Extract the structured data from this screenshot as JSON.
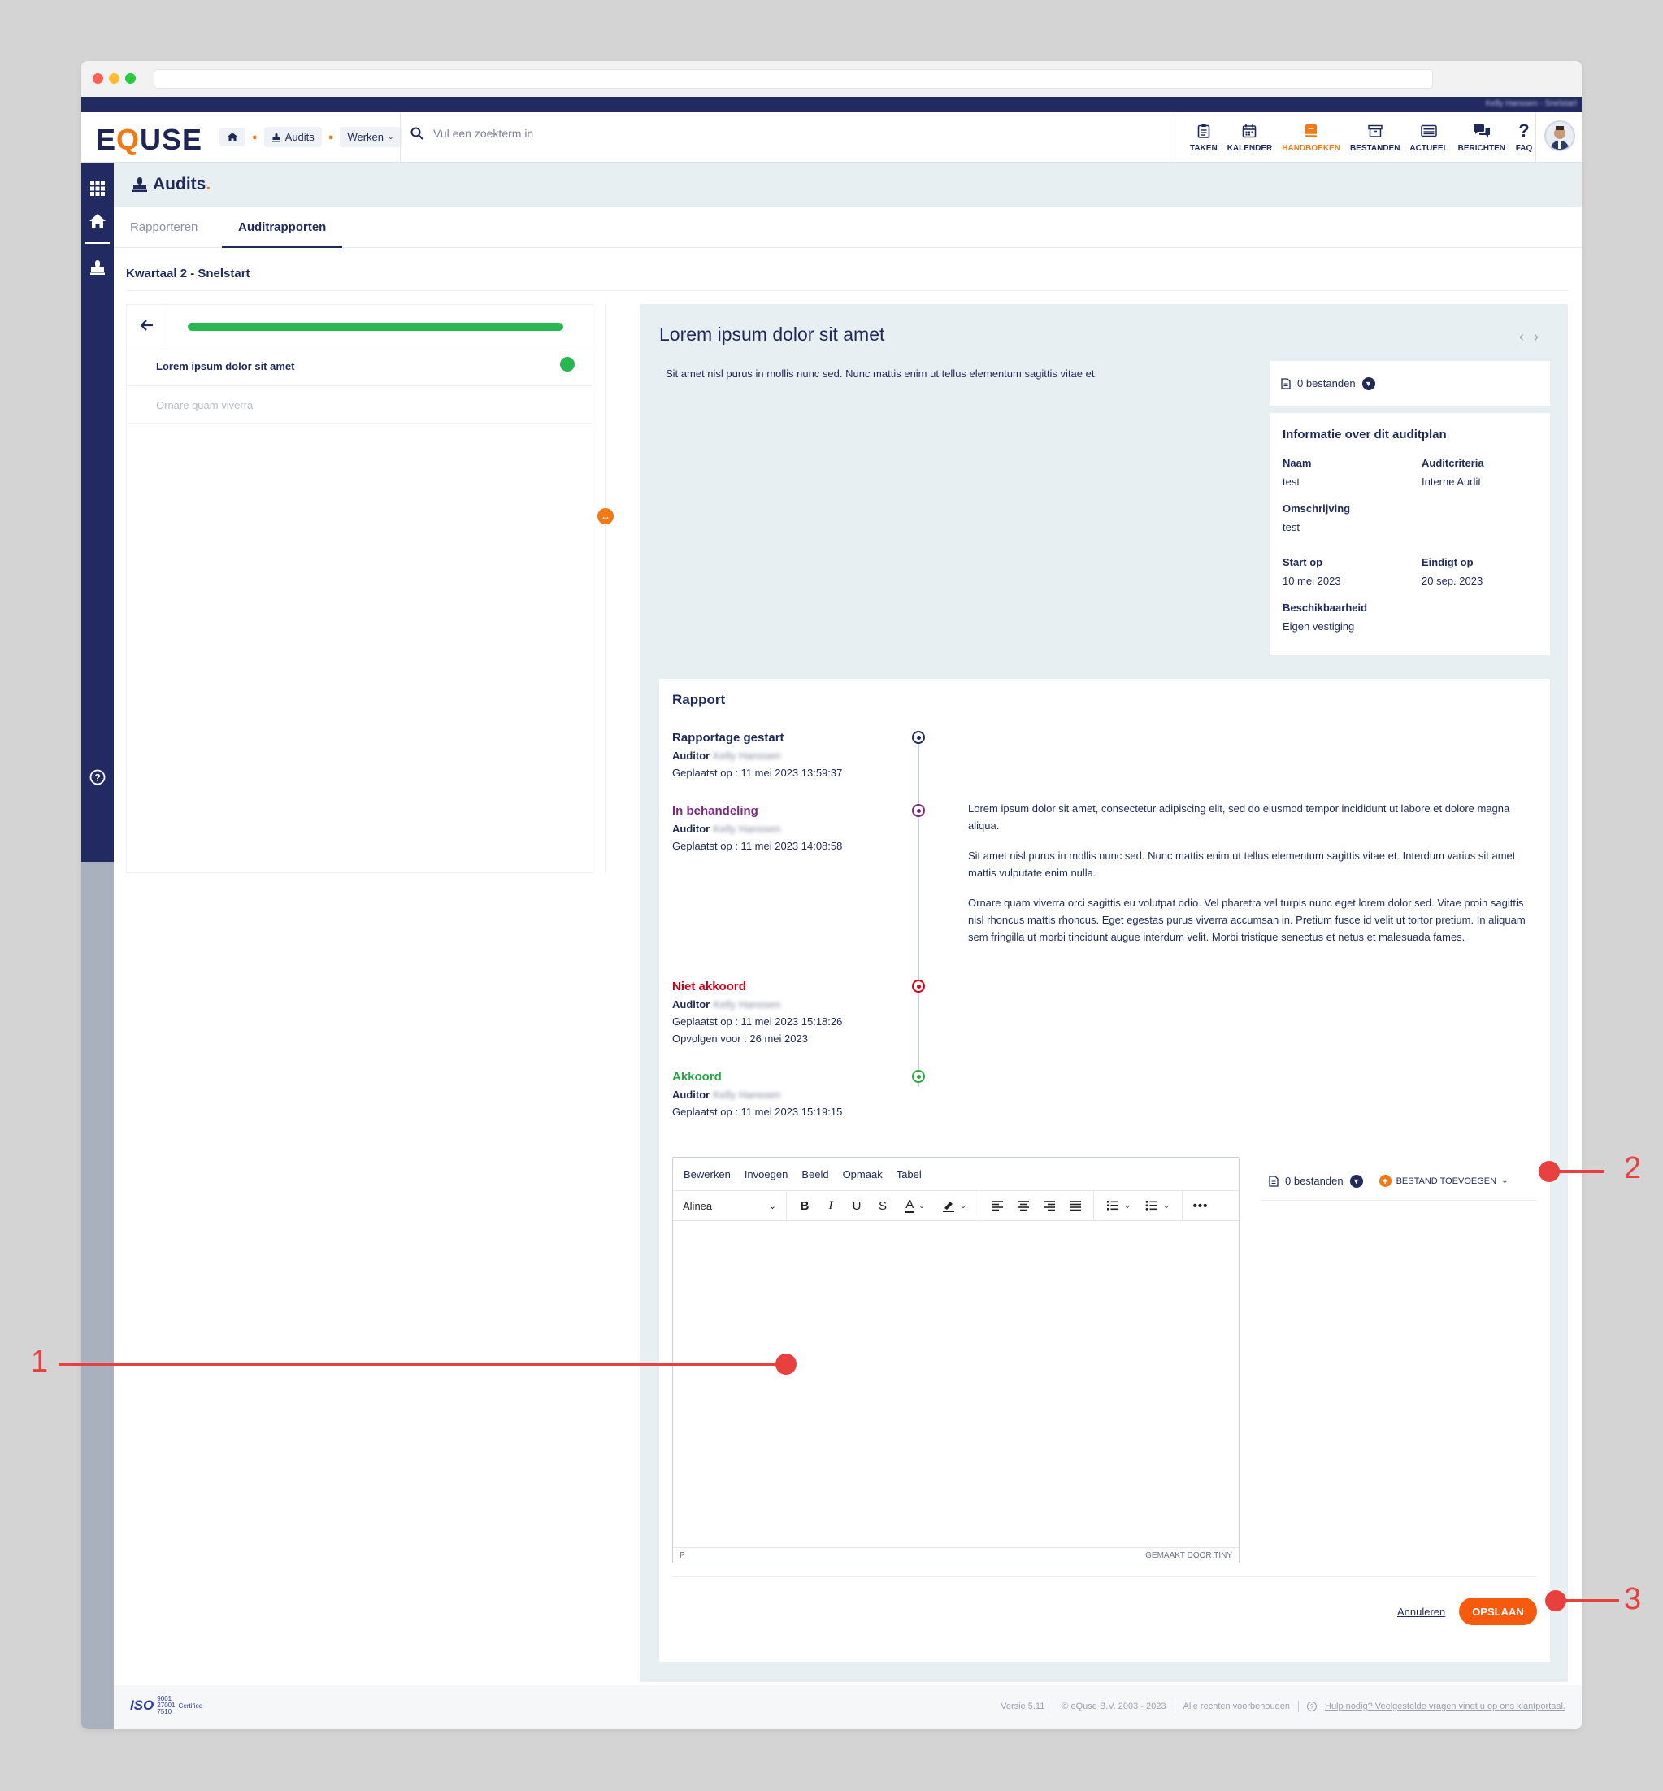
{
  "browser": {
    "url": ""
  },
  "header": {
    "user_name": "Kelly Hanssen - Snelstart",
    "logo": {
      "pre": "E",
      "q": "Q",
      "post": "USE"
    },
    "breadcrumb": [
      {
        "label": "Audits"
      },
      {
        "label": "Werken"
      }
    ],
    "search_placeholder": "Vul een zoekterm in",
    "nav": [
      {
        "label": "TAKEN",
        "icon": "clipboard-icon"
      },
      {
        "label": "KALENDER",
        "icon": "calendar-icon"
      },
      {
        "label": "HANDBOEKEN",
        "icon": "book-icon",
        "active": true
      },
      {
        "label": "BESTANDEN",
        "icon": "archive-icon"
      },
      {
        "label": "ACTUEEL",
        "icon": "news-icon"
      },
      {
        "label": "BERICHTEN",
        "icon": "chat-icon"
      },
      {
        "label": "FAQ",
        "icon": "question-icon"
      }
    ]
  },
  "page": {
    "title": "Audits",
    "title_dot": ".",
    "tabs": [
      "Rapporteren",
      "Auditrapporten"
    ],
    "active_tab": "Auditrapporten",
    "subtitle": "Kwartaal 2 - Snelstart"
  },
  "left_panel": {
    "progress": 1.0,
    "items": [
      {
        "label": "Lorem ipsum dolor sit amet",
        "status": "done"
      },
      {
        "label": "Ornare quam viverra",
        "status": "disabled"
      }
    ]
  },
  "detail": {
    "title": "Lorem ipsum dolor sit amet",
    "description": "Sit amet nisl purus in mollis nunc sed. Nunc mattis enim ut tellus elementum sagittis vitae et.",
    "files_label": "0 bestanden",
    "info": {
      "title": "Informatie over dit auditplan",
      "naam_label": "Naam",
      "naam": "test",
      "criteria_label": "Auditcriteria",
      "criteria": "Interne Audit",
      "omschrijving_label": "Omschrijving",
      "omschrijving": "test",
      "start_label": "Start op",
      "start": "10 mei 2023",
      "end_label": "Eindigt op",
      "end": "20 sep. 2023",
      "beschikbaarheid_label": "Beschikbaarheid",
      "beschikbaarheid": "Eigen vestiging"
    }
  },
  "rapport": {
    "title": "Rapport",
    "auditor_label": "Auditor",
    "auditor_name": "Kelly Hanssen",
    "events": [
      {
        "title": "Rapportage gestart",
        "color": "#1f2a5a",
        "placed": "Geplaatst op : 11 mei 2023 13:59:37"
      },
      {
        "title": "In behandeling",
        "color": "#7a2a7f",
        "placed": "Geplaatst op : 11 mei 2023 14:08:58"
      },
      {
        "title": "Niet akkoord",
        "color": "#d0021b",
        "placed": "Geplaatst op : 11 mei 2023 15:18:26",
        "follow": "Opvolgen voor : 26 mei 2023"
      },
      {
        "title": "Akkoord",
        "color": "#28a745",
        "placed": "Geplaatst op : 11 mei 2023 15:19:15"
      }
    ],
    "paragraphs": [
      "Lorem ipsum dolor sit amet, consectetur adipiscing elit, sed do eiusmod tempor incididunt ut labore et dolore magna aliqua.",
      "Sit amet nisl purus in mollis nunc sed. Nunc mattis enim ut tellus elementum sagittis vitae et. Interdum varius sit amet mattis vulputate enim nulla.",
      "Ornare quam viverra orci sagittis eu volutpat odio. Vel pharetra vel turpis nunc eget lorem dolor sed. Vitae proin sagittis nisl rhoncus mattis rhoncus. Eget egestas purus viverra accumsan in. Pretium fusce id velit ut tortor pretium. In aliquam sem fringilla ut morbi tincidunt augue interdum velit. Morbi tristique senectus et netus et malesuada fames."
    ]
  },
  "editor": {
    "menu": [
      "Bewerken",
      "Invoegen",
      "Beeld",
      "Opmaak",
      "Tabel"
    ],
    "block_format": "Alinea",
    "status_path": "P",
    "branding": "GEMAAKT DOOR TINY"
  },
  "attachments": {
    "files_label": "0 bestanden",
    "add_label": "BESTAND TOEVOEGEN"
  },
  "actions": {
    "cancel": "Annuleren",
    "save": "OPSLAAN"
  },
  "footer": {
    "iso_big": "ISO",
    "iso_numbers": [
      "9001",
      "27001",
      "7510"
    ],
    "iso_certified": "Certified",
    "version": "Versie 5.11",
    "copyright": "© eQuse B.V. 2003 - 2023",
    "rights": "Alle rechten voorbehouden",
    "help": "Hulp nodig? Veelgestelde vragen vindt u op ons klantportaal."
  },
  "annotations": [
    "1",
    "2",
    "3"
  ],
  "colors": {
    "navy": "#222b61",
    "accent": "#f07a17",
    "save": "#f55a0d",
    "annotation": "#e8403f",
    "success": "#28b751"
  }
}
